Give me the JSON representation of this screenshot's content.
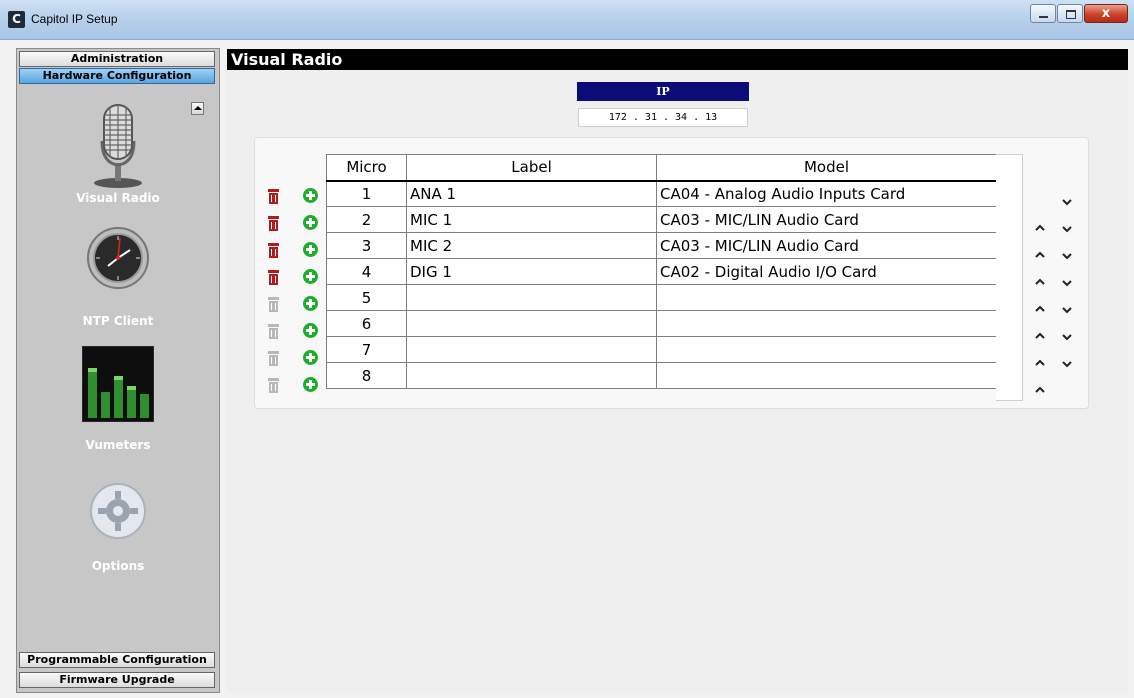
{
  "window": {
    "title": "Capitol IP Setup",
    "icon_letter": "C",
    "close_glyph": "x"
  },
  "sidebar": {
    "top_buttons": [
      "Administration",
      "Hardware Configuration"
    ],
    "bottom_buttons": [
      "Programmable Configuration",
      "Firmware Upgrade"
    ],
    "items": [
      {
        "label": "Visual Radio",
        "icon": "microphone-icon"
      },
      {
        "label": "NTP Client",
        "icon": "clock-icon"
      },
      {
        "label": "Vumeters",
        "icon": "vumeter-icon"
      },
      {
        "label": "Options",
        "icon": "gear-icon"
      }
    ]
  },
  "main": {
    "title": "Visual Radio",
    "ip_label": "IP",
    "ip_value": "172 . 31 . 34 . 13"
  },
  "table": {
    "headers": [
      "Micro",
      "Label",
      "Model"
    ],
    "rows": [
      {
        "micro": "1",
        "label": "ANA 1",
        "model": "CA04 - Analog Audio Inputs Card",
        "enabled": true
      },
      {
        "micro": "2",
        "label": "MIC 1",
        "model": "CA03 - MIC/LIN Audio Card",
        "enabled": true
      },
      {
        "micro": "3",
        "label": "MIC 2",
        "model": "CA03 - MIC/LIN Audio Card",
        "enabled": true
      },
      {
        "micro": "4",
        "label": "DIG 1",
        "model": "CA02 - Digital Audio I/O Card",
        "enabled": true
      },
      {
        "micro": "5",
        "label": "",
        "model": "",
        "enabled": false
      },
      {
        "micro": "6",
        "label": "",
        "model": "",
        "enabled": false
      },
      {
        "micro": "7",
        "label": "",
        "model": "",
        "enabled": false
      },
      {
        "micro": "8",
        "label": "",
        "model": "",
        "enabled": false
      }
    ]
  },
  "colors": {
    "delete_active": "#b01c1c",
    "delete_disabled": "#b8b8b8",
    "add": "#1fae2b",
    "ip_header": "#0c0c78",
    "active_tab": "#5aa6e0"
  }
}
